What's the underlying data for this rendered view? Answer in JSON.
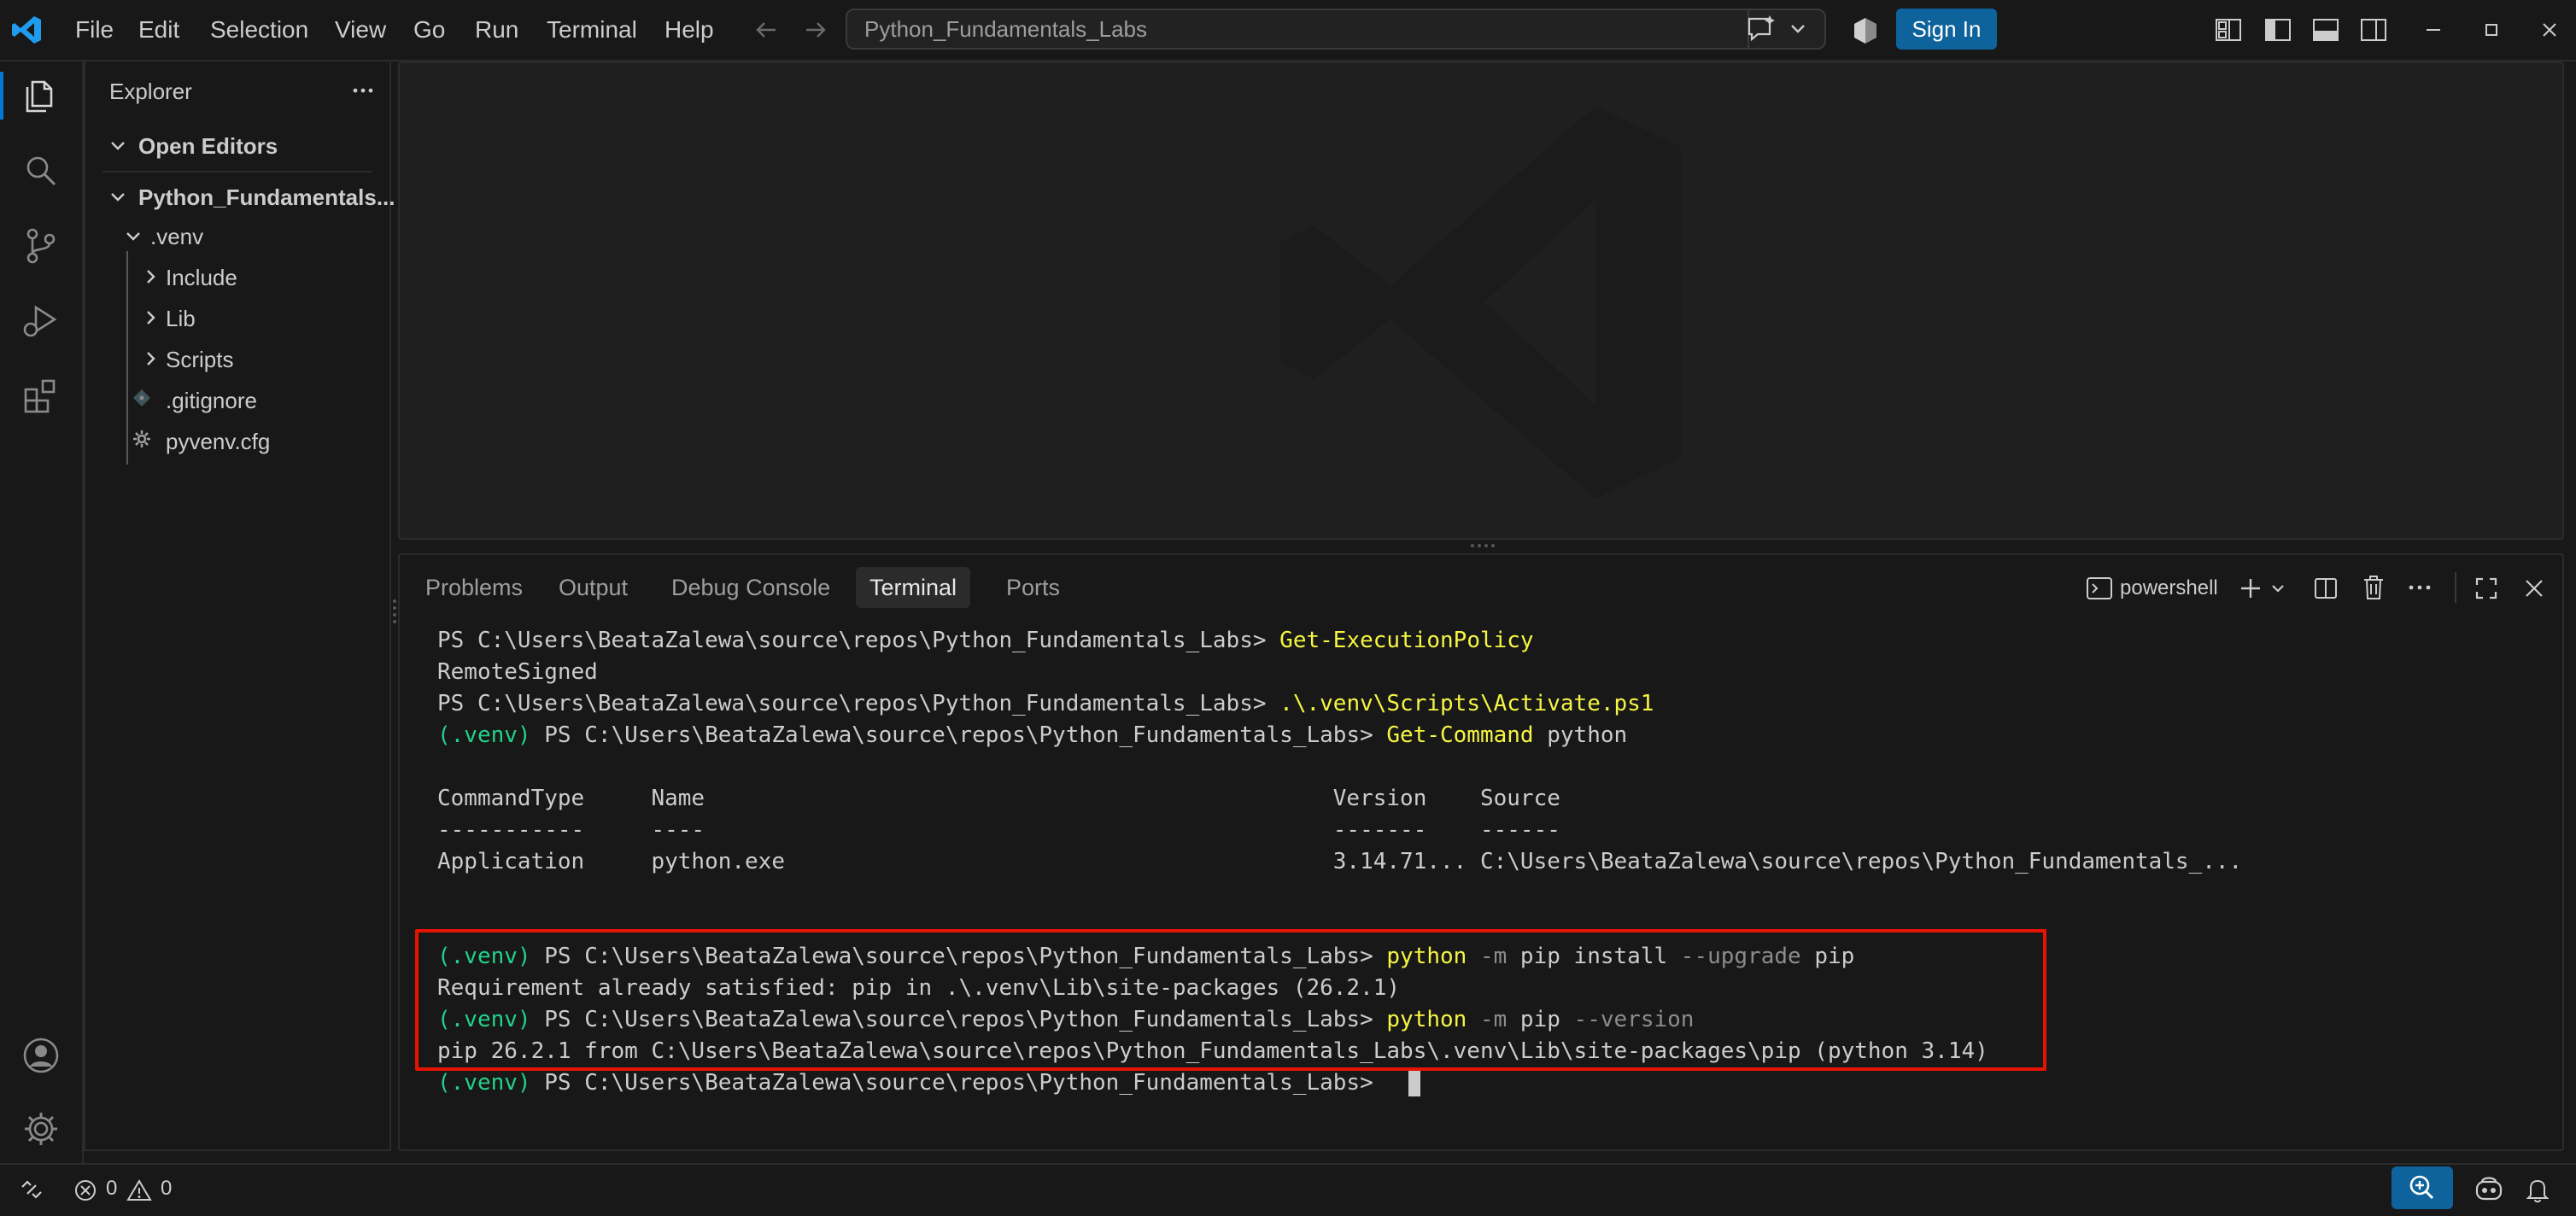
{
  "menu": [
    "File",
    "Edit",
    "Selection",
    "View",
    "Go",
    "Run",
    "Terminal",
    "Help"
  ],
  "command_center": {
    "text": "Python_Fundamentals_Labs"
  },
  "signin_label": "Sign In",
  "sidebar": {
    "title": "Explorer",
    "open_editors": "Open Editors",
    "folder": "Python_Fundamentals...",
    "tree": [
      {
        "label": ".venv",
        "type": "folder-open"
      },
      {
        "label": "Include",
        "type": "folder"
      },
      {
        "label": "Lib",
        "type": "folder"
      },
      {
        "label": "Scripts",
        "type": "folder"
      },
      {
        "label": ".gitignore",
        "type": "git-file"
      },
      {
        "label": "pyvenv.cfg",
        "type": "config-file"
      }
    ]
  },
  "panel": {
    "tabs": [
      "Problems",
      "Output",
      "Debug Console",
      "Terminal",
      "Ports"
    ],
    "active_tab": "Terminal",
    "shell": "powershell"
  },
  "terminal": {
    "l1_prompt": "PS C:\\Users\\BeataZalewa\\source\\repos\\Python_Fundamentals_Labs> ",
    "l1_cmd": "Get-ExecutionPolicy",
    "l2": "RemoteSigned",
    "l3_prompt": "PS C:\\Users\\BeataZalewa\\source\\repos\\Python_Fundamentals_Labs> ",
    "l3_cmd": ".\\.venv\\Scripts\\Activate.ps1",
    "venv": "(.venv)",
    "prompt": " PS C:\\Users\\BeataZalewa\\source\\repos\\Python_Fundamentals_Labs> ",
    "l4_cmd": "Get-Command",
    "l4_arg": " python",
    "table_header": "CommandType     Name                                               Version    Source",
    "table_sep": "-----------     ----                                               -------    ------",
    "table_row": "Application     python.exe                                         3.14.71... C:\\Users\\BeataZalewa\\source\\repos\\Python_Fundamentals_...",
    "l8_python": "python",
    "l8_flag": " -m",
    "l8_mid": " pip install",
    "l8_flag2": " --upgrade",
    "l8_end": " pip",
    "l9": "Requirement already satisfied: pip in .\\.venv\\Lib\\site-packages (26.2.1)",
    "l10_python": "python",
    "l10_flag": " -m",
    "l10_mid": " pip",
    "l10_flag2": " --version",
    "l11": "pip 26.2.1 from C:\\Users\\BeataZalewa\\source\\repos\\Python_Fundamentals_Labs\\.venv\\Lib\\site-packages\\pip (python 3.14)"
  },
  "status": {
    "errors": "0",
    "warnings": "0"
  },
  "icons": {
    "vscode": "vscode-logo-icon",
    "explorer": "files-icon",
    "search": "search-icon",
    "scm": "source-control-icon",
    "debug": "run-debug-icon",
    "extensions": "extensions-icon",
    "account": "account-icon",
    "settings": "gear-icon"
  },
  "colors": {
    "accent": "#0e639c",
    "highlight": "#e51400",
    "venv": "#23d18b",
    "command": "#f5f543"
  }
}
